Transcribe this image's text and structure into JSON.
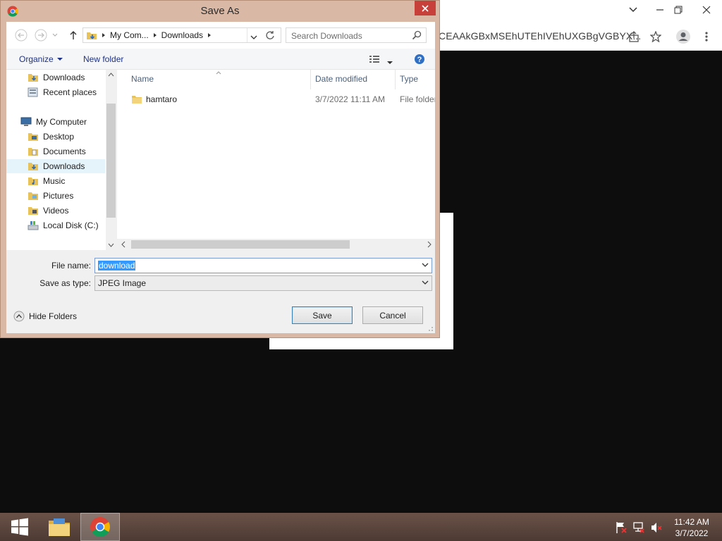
{
  "browser": {
    "url_fragment": "CEAAkGBxMSEhUTEhIVEhUXGBgVGBYX..."
  },
  "dialog": {
    "title": "Save As",
    "address": {
      "crumbs": [
        "My Com...",
        "Downloads"
      ]
    },
    "search_placeholder": "Search Downloads",
    "commands": {
      "organize": "Organize",
      "new_folder": "New folder"
    },
    "tree": [
      {
        "label": "Downloads",
        "icon": "downloads-folder-icon"
      },
      {
        "label": "Recent places",
        "icon": "recent-places-icon"
      },
      {
        "label": "My Computer",
        "icon": "computer-icon"
      },
      {
        "label": "Desktop",
        "icon": "desktop-folder-icon"
      },
      {
        "label": "Documents",
        "icon": "documents-folder-icon"
      },
      {
        "label": "Downloads",
        "icon": "downloads-folder-icon",
        "selected": true
      },
      {
        "label": "Music",
        "icon": "music-folder-icon"
      },
      {
        "label": "Pictures",
        "icon": "pictures-folder-icon"
      },
      {
        "label": "Videos",
        "icon": "videos-folder-icon"
      },
      {
        "label": "Local Disk (C:)",
        "icon": "disk-icon"
      }
    ],
    "columns": [
      "Name",
      "Date modified",
      "Type"
    ],
    "files": [
      {
        "name": "hamtaro",
        "date": "3/7/2022 11:11 AM",
        "type": "File folder"
      }
    ],
    "form": {
      "filename_label": "File name:",
      "filename_value": "download",
      "savetype_label": "Save as type:",
      "savetype_value": "JPEG Image"
    },
    "hide_folders": "Hide Folders",
    "save": "Save",
    "cancel": "Cancel"
  },
  "taskbar": {
    "time": "11:42 AM",
    "date": "3/7/2022"
  },
  "colors": {
    "dialog_frame": "#d9b9a5",
    "close_red": "#c7413a",
    "selection": "#3399ff",
    "taskbar": "#5a453d"
  }
}
